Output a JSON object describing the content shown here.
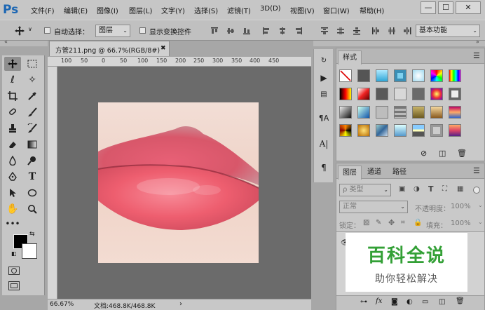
{
  "app": {
    "logo": "Ps"
  },
  "menu": [
    "文件(F)",
    "编辑(E)",
    "图像(I)",
    "图层(L)",
    "文字(Y)",
    "选择(S)",
    "滤镜(T)",
    "3D(D)",
    "视图(V)",
    "窗口(W)",
    "帮助(H)"
  ],
  "window_controls": {
    "minimize": "—",
    "restore": "☐",
    "close": "✕"
  },
  "options_bar": {
    "tool_icon": "move-tool-icon",
    "auto_select_label": "自动选择：",
    "auto_select_value": "图层",
    "show_transform_label": "显示变换控件",
    "workspace": "基本功能"
  },
  "document": {
    "tab_title": "方管211.png @ 66.7%(RGB/8#)",
    "tab_close": "✖",
    "ruler_labels": [
      "100",
      "50",
      "0",
      "50",
      "100",
      "150",
      "200",
      "250",
      "300",
      "350",
      "400",
      "450"
    ],
    "image_description_icon": "lips-photo"
  },
  "status": {
    "zoom": "66.67%",
    "doc_info": "文档:468.8K/468.8K",
    "arrow": "›"
  },
  "styles_panel": {
    "tab": "样式"
  },
  "layers_panel": {
    "tabs": [
      "图层",
      "通道",
      "路径"
    ],
    "filter_label": "ρ 类型",
    "blend_mode": "正常",
    "opacity_label": "不透明度：",
    "opacity_value": "100%",
    "lock_label": "锁定：",
    "fill_label": "填充：",
    "fill_value": "100%"
  },
  "watermark": {
    "title": "百科全说",
    "subtitle": "助你轻松解决"
  },
  "colors": {
    "menubar": "#c6c6c6",
    "canvas_bg": "#6b6b6b",
    "accent_green": "#33a036",
    "ps_blue": "#1b66b3"
  }
}
